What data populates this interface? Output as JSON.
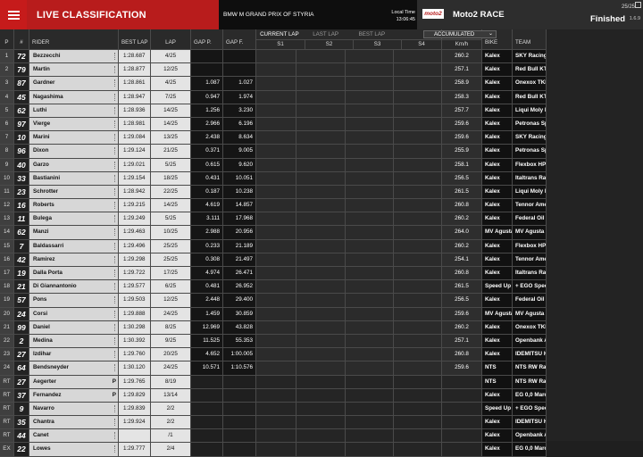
{
  "header": {
    "title": "LIVE CLASSIFICATION",
    "event": "BMW M GRAND PRIX OF STYRIA",
    "local_time_label": "Local Time",
    "local_time": "13:06:45",
    "series_logo": "moto2",
    "race": "Moto2 RACE",
    "lap_count": "25/25",
    "status": "Finished",
    "version": "1.6.9"
  },
  "columns": {
    "p": "P",
    "num": "#",
    "rider": "RIDER",
    "best_lap": "BEST LAP",
    "lap": "LAP",
    "gap_p": "GAP P.",
    "gap_f": "GAP F.",
    "current_lap": "CURRENT LAP",
    "last_lap": "LAST LAP",
    "best_lap_tab": "BEST LAP",
    "accumulated": "ACCUMULATED",
    "s1": "S1",
    "s2": "S2",
    "s3": "S3",
    "s4": "S4",
    "kmh": "Km/h",
    "bike": "BIKE",
    "team": "TEAM"
  },
  "rows": [
    {
      "p": "1",
      "num": "72",
      "rider": "Bezzecchi",
      "tag": "",
      "best": "1:28.687",
      "lap": "4/25",
      "gp": "",
      "gf": "",
      "kmh": "260.2",
      "bike": "Kalex",
      "team": "SKY Racing Team VR46"
    },
    {
      "p": "2",
      "num": "79",
      "rider": "Martin",
      "tag": "",
      "best": "1:28.877",
      "lap": "12/25",
      "gp": "",
      "gf": "",
      "kmh": "257.1",
      "bike": "Kalex",
      "team": "Red Bull KTM Ajo"
    },
    {
      "p": "3",
      "num": "87",
      "rider": "Gardner",
      "tag": "",
      "best": "1:28.861",
      "lap": "4/25",
      "gp": "1.087",
      "gf": "1.027",
      "kmh": "258.9",
      "bike": "Kalex",
      "team": "Onexox TKKR SAG Team"
    },
    {
      "p": "4",
      "num": "45",
      "rider": "Nagashima",
      "tag": "",
      "best": "1:28.947",
      "lap": "7/25",
      "gp": "0.947",
      "gf": "1.974",
      "kmh": "258.3",
      "bike": "Kalex",
      "team": "Red Bull KTM Ajo"
    },
    {
      "p": "5",
      "num": "62",
      "rider": "Luthi",
      "tag": "",
      "best": "1:28.936",
      "lap": "14/25",
      "gp": "1.256",
      "gf": "3.230",
      "kmh": "257.7",
      "bike": "Kalex",
      "team": "Liqui Moly Intact GP"
    },
    {
      "p": "6",
      "num": "97",
      "rider": "Vierge",
      "tag": "",
      "best": "1:28.981",
      "lap": "14/25",
      "gp": "2.966",
      "gf": "6.196",
      "kmh": "259.6",
      "bike": "Kalex",
      "team": "Petronas Sprinta Racing"
    },
    {
      "p": "7",
      "num": "10",
      "rider": "Marini",
      "tag": "",
      "best": "1:29.084",
      "lap": "13/25",
      "gp": "2.438",
      "gf": "8.634",
      "kmh": "259.6",
      "bike": "Kalex",
      "team": "SKY Racing Team VR46"
    },
    {
      "p": "8",
      "num": "96",
      "rider": "Dixon",
      "tag": "",
      "best": "1:29.124",
      "lap": "21/25",
      "gp": "0.371",
      "gf": "9.005",
      "kmh": "255.9",
      "bike": "Kalex",
      "team": "Petronas Sprinta Racing"
    },
    {
      "p": "9",
      "num": "40",
      "rider": "Garzo",
      "tag": "",
      "best": "1:29.021",
      "lap": "5/25",
      "gp": "0.615",
      "gf": "9.620",
      "kmh": "258.1",
      "bike": "Kalex",
      "team": "Flexbox HP 40"
    },
    {
      "p": "10",
      "num": "33",
      "rider": "Bastianini",
      "tag": "",
      "best": "1:29.154",
      "lap": "18/25",
      "gp": "0.431",
      "gf": "10.051",
      "kmh": "256.5",
      "bike": "Kalex",
      "team": "Italtrans Racing Team"
    },
    {
      "p": "11",
      "num": "23",
      "rider": "Schrotter",
      "tag": "",
      "best": "1:28.942",
      "lap": "22/25",
      "gp": "0.187",
      "gf": "10.238",
      "kmh": "261.5",
      "bike": "Kalex",
      "team": "Liqui Moly Intact GP"
    },
    {
      "p": "12",
      "num": "16",
      "rider": "Roberts",
      "tag": "",
      "best": "1:29.215",
      "lap": "14/25",
      "gp": "4.619",
      "gf": "14.857",
      "kmh": "260.8",
      "bike": "Kalex",
      "team": "Tennor American Racing"
    },
    {
      "p": "13",
      "num": "11",
      "rider": "Bulega",
      "tag": "",
      "best": "1:29.249",
      "lap": "5/25",
      "gp": "3.111",
      "gf": "17.968",
      "kmh": "260.2",
      "bike": "Kalex",
      "team": "Federal Oil Gresini Moto2"
    },
    {
      "p": "14",
      "num": "62",
      "rider": "Manzi",
      "tag": "",
      "best": "1:29.463",
      "lap": "10/25",
      "gp": "2.988",
      "gf": "20.956",
      "kmh": "264.0",
      "bike": "MV Agusta",
      "team": "MV Agusta Forward Racing"
    },
    {
      "p": "15",
      "num": "7",
      "rider": "Baldassarri",
      "tag": "",
      "best": "1:29.496",
      "lap": "25/25",
      "gp": "0.233",
      "gf": "21.189",
      "kmh": "260.2",
      "bike": "Kalex",
      "team": "Flexbox HP 40"
    },
    {
      "p": "16",
      "num": "42",
      "rider": "Ramirez",
      "tag": "",
      "best": "1:29.298",
      "lap": "25/25",
      "gp": "0.308",
      "gf": "21.497",
      "kmh": "254.1",
      "bike": "Kalex",
      "team": "Tennor American Racing"
    },
    {
      "p": "17",
      "num": "19",
      "rider": "Dalla Porta",
      "tag": "",
      "best": "1:29.722",
      "lap": "17/25",
      "gp": "4.974",
      "gf": "26.471",
      "kmh": "260.8",
      "bike": "Kalex",
      "team": "Italtrans Racing Team"
    },
    {
      "p": "18",
      "num": "21",
      "rider": "Di Giannantonio",
      "tag": "",
      "best": "1:29.577",
      "lap": "6/25",
      "gp": "0.481",
      "gf": "26.952",
      "kmh": "261.5",
      "bike": "Speed Up",
      "team": "+ EGO Speed Up"
    },
    {
      "p": "19",
      "num": "57",
      "rider": "Pons",
      "tag": "",
      "best": "1:29.503",
      "lap": "12/25",
      "gp": "2.448",
      "gf": "29.400",
      "kmh": "256.5",
      "bike": "Kalex",
      "team": "Federal Oil Gresini Moto2"
    },
    {
      "p": "20",
      "num": "24",
      "rider": "Corsi",
      "tag": "",
      "best": "1:29.888",
      "lap": "24/25",
      "gp": "1.459",
      "gf": "30.859",
      "kmh": "259.6",
      "bike": "MV Agusta",
      "team": "MV Agusta Forward Racing"
    },
    {
      "p": "21",
      "num": "99",
      "rider": "Daniel",
      "tag": "",
      "best": "1:30.298",
      "lap": "8/25",
      "gp": "12.969",
      "gf": "43.828",
      "kmh": "260.2",
      "bike": "Kalex",
      "team": "Onexox TKKR SAG Team"
    },
    {
      "p": "22",
      "num": "2",
      "rider": "Medina",
      "tag": "",
      "best": "1:30.392",
      "lap": "9/25",
      "gp": "11.525",
      "gf": "55.353",
      "kmh": "257.1",
      "bike": "Kalex",
      "team": "Openbank Aspar Team"
    },
    {
      "p": "23",
      "num": "27",
      "rider": "Izdihar",
      "tag": "",
      "best": "1:29.760",
      "lap": "20/25",
      "gp": "4.652",
      "gf": "1:00.005",
      "kmh": "260.8",
      "bike": "Kalex",
      "team": "IDEMITSU Honda Team Asia"
    },
    {
      "p": "24",
      "num": "64",
      "rider": "Bendsneyder",
      "tag": "",
      "best": "1:30.120",
      "lap": "24/25",
      "gp": "10.571",
      "gf": "1:10.576",
      "kmh": "259.6",
      "bike": "NTS",
      "team": "NTS RW Racing GP"
    },
    {
      "p": "RT",
      "num": "27",
      "rider": "Aegerter",
      "tag": "P",
      "best": "1:29.765",
      "lap": "8/19",
      "gp": "",
      "gf": "",
      "kmh": "",
      "bike": "NTS",
      "team": "NTS RW Racing GP",
      "retired": true
    },
    {
      "p": "RT",
      "num": "37",
      "rider": "Fernandez",
      "tag": "P",
      "best": "1:29.829",
      "lap": "13/14",
      "gp": "",
      "gf": "",
      "kmh": "",
      "bike": "Kalex",
      "team": "EG 0,0 Marc VDS",
      "retired": true
    },
    {
      "p": "RT",
      "num": "9",
      "rider": "Navarro",
      "tag": "",
      "best": "1:29.839",
      "lap": "2/2",
      "gp": "",
      "gf": "",
      "kmh": "",
      "bike": "Speed Up",
      "team": "+ EGO Speed Up",
      "retired": true
    },
    {
      "p": "RT",
      "num": "35",
      "rider": "Chantra",
      "tag": "",
      "best": "1:29.924",
      "lap": "2/2",
      "gp": "",
      "gf": "",
      "kmh": "",
      "bike": "Kalex",
      "team": "IDEMITSU Honda Team Asia",
      "retired": true
    },
    {
      "p": "RT",
      "num": "44",
      "rider": "Canet",
      "tag": "",
      "best": "",
      "lap": "/1",
      "gp": "",
      "gf": "",
      "kmh": "",
      "bike": "Kalex",
      "team": "Openbank Aspar Team",
      "retired": true
    },
    {
      "p": "EX",
      "num": "22",
      "rider": "Lowes",
      "tag": "",
      "best": "1:29.777",
      "lap": "2/4",
      "gp": "",
      "gf": "",
      "kmh": "",
      "bike": "Kalex",
      "team": "EG 0,0 Marc VDS",
      "retired": true
    }
  ]
}
